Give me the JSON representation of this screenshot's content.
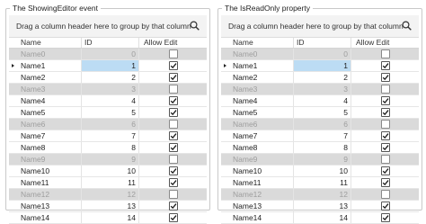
{
  "panels": [
    {
      "title": "The ShowingEditor event",
      "group_hint": "Drag a column header here to group by that column",
      "columns": [
        "Name",
        "ID",
        "Allow Edit"
      ],
      "rows": [
        {
          "name": "Name0",
          "id": "0",
          "allow_edit": false,
          "readonly": true
        },
        {
          "name": "Name1",
          "id": "1",
          "allow_edit": true,
          "readonly": false,
          "current": true
        },
        {
          "name": "Name2",
          "id": "2",
          "allow_edit": true,
          "readonly": false
        },
        {
          "name": "Name3",
          "id": "3",
          "allow_edit": false,
          "readonly": true
        },
        {
          "name": "Name4",
          "id": "4",
          "allow_edit": true,
          "readonly": false
        },
        {
          "name": "Name5",
          "id": "5",
          "allow_edit": true,
          "readonly": false
        },
        {
          "name": "Name6",
          "id": "6",
          "allow_edit": false,
          "readonly": true
        },
        {
          "name": "Name7",
          "id": "7",
          "allow_edit": true,
          "readonly": false
        },
        {
          "name": "Name8",
          "id": "8",
          "allow_edit": true,
          "readonly": false
        },
        {
          "name": "Name9",
          "id": "9",
          "allow_edit": false,
          "readonly": true
        },
        {
          "name": "Name10",
          "id": "10",
          "allow_edit": true,
          "readonly": false
        },
        {
          "name": "Name11",
          "id": "11",
          "allow_edit": true,
          "readonly": false
        },
        {
          "name": "Name12",
          "id": "12",
          "allow_edit": false,
          "readonly": true
        },
        {
          "name": "Name13",
          "id": "13",
          "allow_edit": true,
          "readonly": false
        },
        {
          "name": "Name14",
          "id": "14",
          "allow_edit": true,
          "readonly": false
        }
      ]
    },
    {
      "title": "The IsReadOnly property",
      "group_hint": "Drag a column header here to group by that column",
      "columns": [
        "Name",
        "ID",
        "Allow Edit"
      ],
      "rows": [
        {
          "name": "Name0",
          "id": "0",
          "allow_edit": false,
          "readonly": true
        },
        {
          "name": "Name1",
          "id": "1",
          "allow_edit": true,
          "readonly": false,
          "current": true
        },
        {
          "name": "Name2",
          "id": "2",
          "allow_edit": true,
          "readonly": false
        },
        {
          "name": "Name3",
          "id": "3",
          "allow_edit": false,
          "readonly": true
        },
        {
          "name": "Name4",
          "id": "4",
          "allow_edit": true,
          "readonly": false
        },
        {
          "name": "Name5",
          "id": "5",
          "allow_edit": true,
          "readonly": false
        },
        {
          "name": "Name6",
          "id": "6",
          "allow_edit": false,
          "readonly": true
        },
        {
          "name": "Name7",
          "id": "7",
          "allow_edit": true,
          "readonly": false
        },
        {
          "name": "Name8",
          "id": "8",
          "allow_edit": true,
          "readonly": false
        },
        {
          "name": "Name9",
          "id": "9",
          "allow_edit": false,
          "readonly": true
        },
        {
          "name": "Name10",
          "id": "10",
          "allow_edit": true,
          "readonly": false
        },
        {
          "name": "Name11",
          "id": "11",
          "allow_edit": true,
          "readonly": false
        },
        {
          "name": "Name12",
          "id": "12",
          "allow_edit": false,
          "readonly": true
        },
        {
          "name": "Name13",
          "id": "13",
          "allow_edit": true,
          "readonly": false
        },
        {
          "name": "Name14",
          "id": "14",
          "allow_edit": true,
          "readonly": false
        }
      ]
    }
  ],
  "colors": {
    "readonly_row_bg": "#dadada",
    "selected_cell_bg": "#bcdcf4",
    "group_panel_bg": "#f3f3f3"
  },
  "icons": {
    "search": "search-icon",
    "row_indicator": "row-indicator-icon",
    "checkbox_check": "check-icon"
  }
}
